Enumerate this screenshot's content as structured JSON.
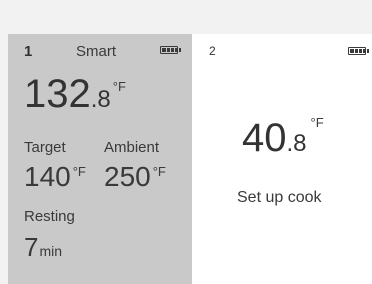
{
  "header": {
    "title": ""
  },
  "probe1": {
    "number": "1",
    "mode": "Smart",
    "battery_icon": "battery-full-icon",
    "battery_level": 1.0,
    "temp_whole": "132",
    "temp_decimal": ".8",
    "temp_unit": "°F",
    "target_label": "Target",
    "target_value": "140",
    "target_unit": "°F",
    "ambient_label": "Ambient",
    "ambient_value": "250",
    "ambient_unit": "°F",
    "resting_label": "Resting",
    "resting_value": "7",
    "resting_unit": "min"
  },
  "probe2": {
    "number": "2",
    "battery_icon": "battery-full-icon",
    "battery_level": 1.0,
    "temp_whole": "40",
    "temp_decimal": ".8",
    "temp_unit": "°F",
    "setup_label": "Set up cook"
  }
}
